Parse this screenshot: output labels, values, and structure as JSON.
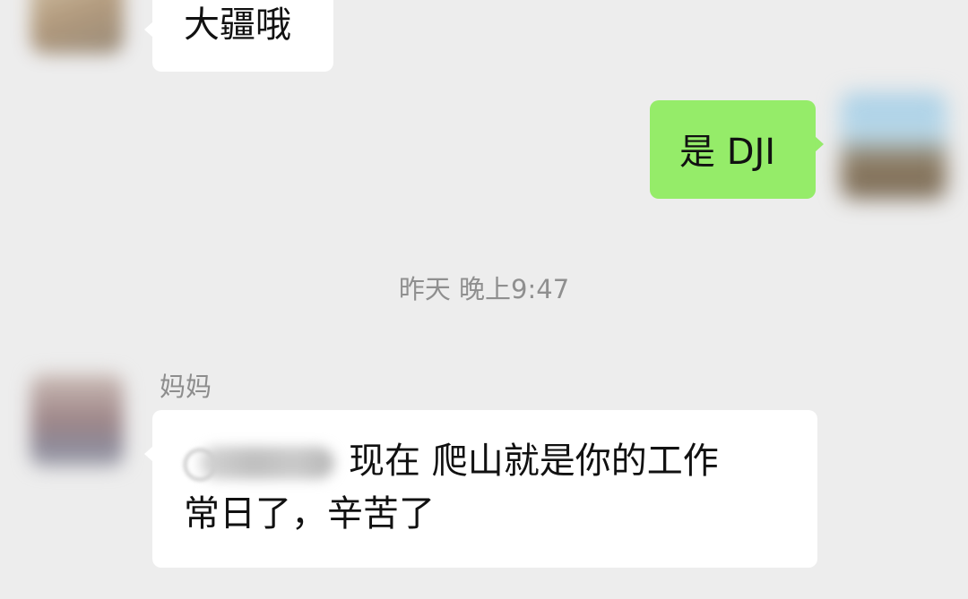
{
  "messages": {
    "top_in": {
      "text": "大疆哦"
    },
    "out_dji": {
      "text": "是 DJI"
    },
    "timestamp": "昨天 晚上9:47",
    "mom": {
      "sender": "妈妈",
      "line1_text": "现在  爬山就是你的工作",
      "line2_text": "常日了，辛苦了"
    }
  },
  "colors": {
    "background": "#ededed",
    "outgoing_bubble": "#95ec69",
    "incoming_bubble": "#ffffff"
  }
}
